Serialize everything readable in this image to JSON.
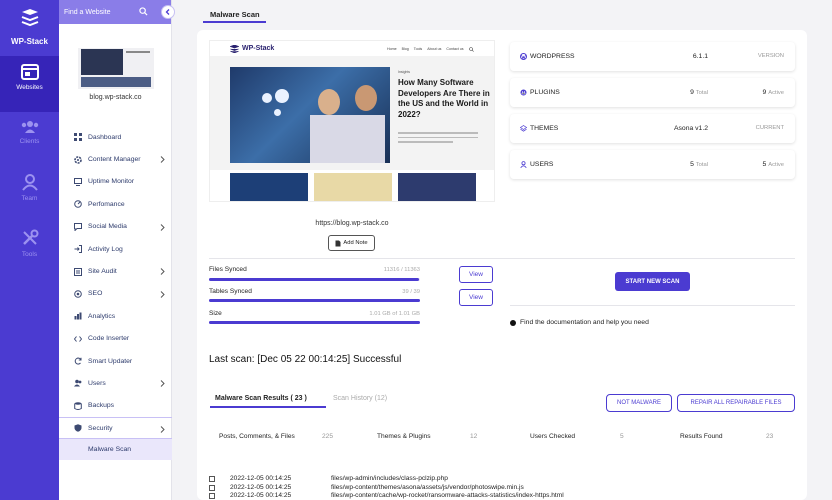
{
  "brand": {
    "name": "WP-Stack"
  },
  "rail": [
    {
      "label": "Websites",
      "icon": "browser-window-icon",
      "active": true
    },
    {
      "label": "Clients",
      "icon": "group-icon"
    },
    {
      "label": "Team",
      "icon": "user-icon"
    },
    {
      "label": "Tools",
      "icon": "tools-icon"
    }
  ],
  "sidebar": {
    "find_placeholder": "Find a Website",
    "site_url": "blog.wp-stack.co",
    "nav": [
      {
        "label": "Dashboard",
        "icon": "grid-icon",
        "chevron": false
      },
      {
        "label": "Content Manager",
        "icon": "gear-icon",
        "chevron": true
      },
      {
        "label": "Uptime Monitor",
        "icon": "monitor-icon",
        "chevron": false
      },
      {
        "label": "Perfomance",
        "icon": "gauge-icon",
        "chevron": false
      },
      {
        "label": "Social Media",
        "icon": "chat-icon",
        "chevron": true
      },
      {
        "label": "Activity Log",
        "icon": "login-icon",
        "chevron": false
      },
      {
        "label": "Site Audit",
        "icon": "audit-icon",
        "chevron": true
      },
      {
        "label": "SEO",
        "icon": "target-icon",
        "chevron": true
      },
      {
        "label": "Analytics",
        "icon": "analytics-icon",
        "chevron": false
      },
      {
        "label": "Code Inserter",
        "icon": "code-icon",
        "chevron": false
      },
      {
        "label": "Smart Updater",
        "icon": "refresh-icon",
        "chevron": false
      },
      {
        "label": "Users",
        "icon": "users-icon",
        "chevron": true
      },
      {
        "label": "Backups",
        "icon": "database-icon",
        "chevron": false
      },
      {
        "label": "Security",
        "icon": "shield-icon",
        "chevron": true,
        "selected": true
      }
    ],
    "sub_item": "Malware Scan"
  },
  "page": {
    "tab_title": "Malware Scan"
  },
  "preview": {
    "logo": "WP-Stack",
    "menu": [
      "Home",
      "Blog",
      "Tools",
      "About us",
      "Contact us"
    ],
    "tag": "Insights",
    "title": "How Many Software Developers Are There in the US and the World in 2022?",
    "url": "https://blog.wp-stack.co",
    "add_note": "Add Note"
  },
  "info": [
    {
      "label": "WORDPRESS",
      "icon": "wordpress-icon",
      "v1": "6.1.1",
      "v1_unit": "",
      "v2": "",
      "v2_unit": "VERSION"
    },
    {
      "label": "PLUGINS",
      "icon": "plugin-icon",
      "v1": "9",
      "v1_unit": "Total",
      "v2": "9",
      "v2_unit": "Active"
    },
    {
      "label": "THEMES",
      "icon": "themes-icon",
      "v1": "Asona v1.2",
      "v1_unit": "",
      "v2": "",
      "v2_unit": "CURRENT"
    },
    {
      "label": "USERS",
      "icon": "user-icon",
      "v1": "5",
      "v1_unit": "Total",
      "v2": "5",
      "v2_unit": "Active"
    }
  ],
  "sync": [
    {
      "label": "Files Synced",
      "value": "11316 / 11363",
      "fraction": 0.996
    },
    {
      "label": "Tables Synced",
      "value": "39 / 39",
      "fraction": 1.0
    },
    {
      "label": "Size",
      "value": "1.01 GB of 1.01 GB",
      "fraction": 1.0
    }
  ],
  "buttons": {
    "view": "View",
    "start_scan": "START NEW SCAN",
    "not_malware": "NOT MALWARE",
    "repair_all": "REPAIR ALL REPAIRABLE FILES"
  },
  "doc_link": "Find the documentation and help you need",
  "last_scan": "Last scan: [Dec 05 22 00:14:25] Successful",
  "results": {
    "tab_active": "Malware Scan Results ( 23 )",
    "tab_history": "Scan History (12)",
    "stats": [
      {
        "label": "Posts, Comments, & Files",
        "count": "225"
      },
      {
        "label": "Themes & Plugins",
        "count": "12"
      },
      {
        "label": "Users Checked",
        "count": "5"
      },
      {
        "label": "Results Found",
        "count": "23"
      }
    ],
    "rows": [
      {
        "date": "2022-12-05 00:14:25",
        "path": "files/wp-admin/includes/class-pclzip.php"
      },
      {
        "date": "2022-12-05 00:14:25",
        "path": "files/wp-content/themes/asona/assets/js/vendor/photoswipe.min.js"
      },
      {
        "date": "2022-12-05 00:14:25",
        "path": "files/wp-content/cache/wp-rocket/ransomware-attacks-statistics/index-https.html"
      }
    ]
  },
  "colors": {
    "accent": "#4b3bd1",
    "rail": "#4b3bd1",
    "finder": "#8a7de8"
  }
}
